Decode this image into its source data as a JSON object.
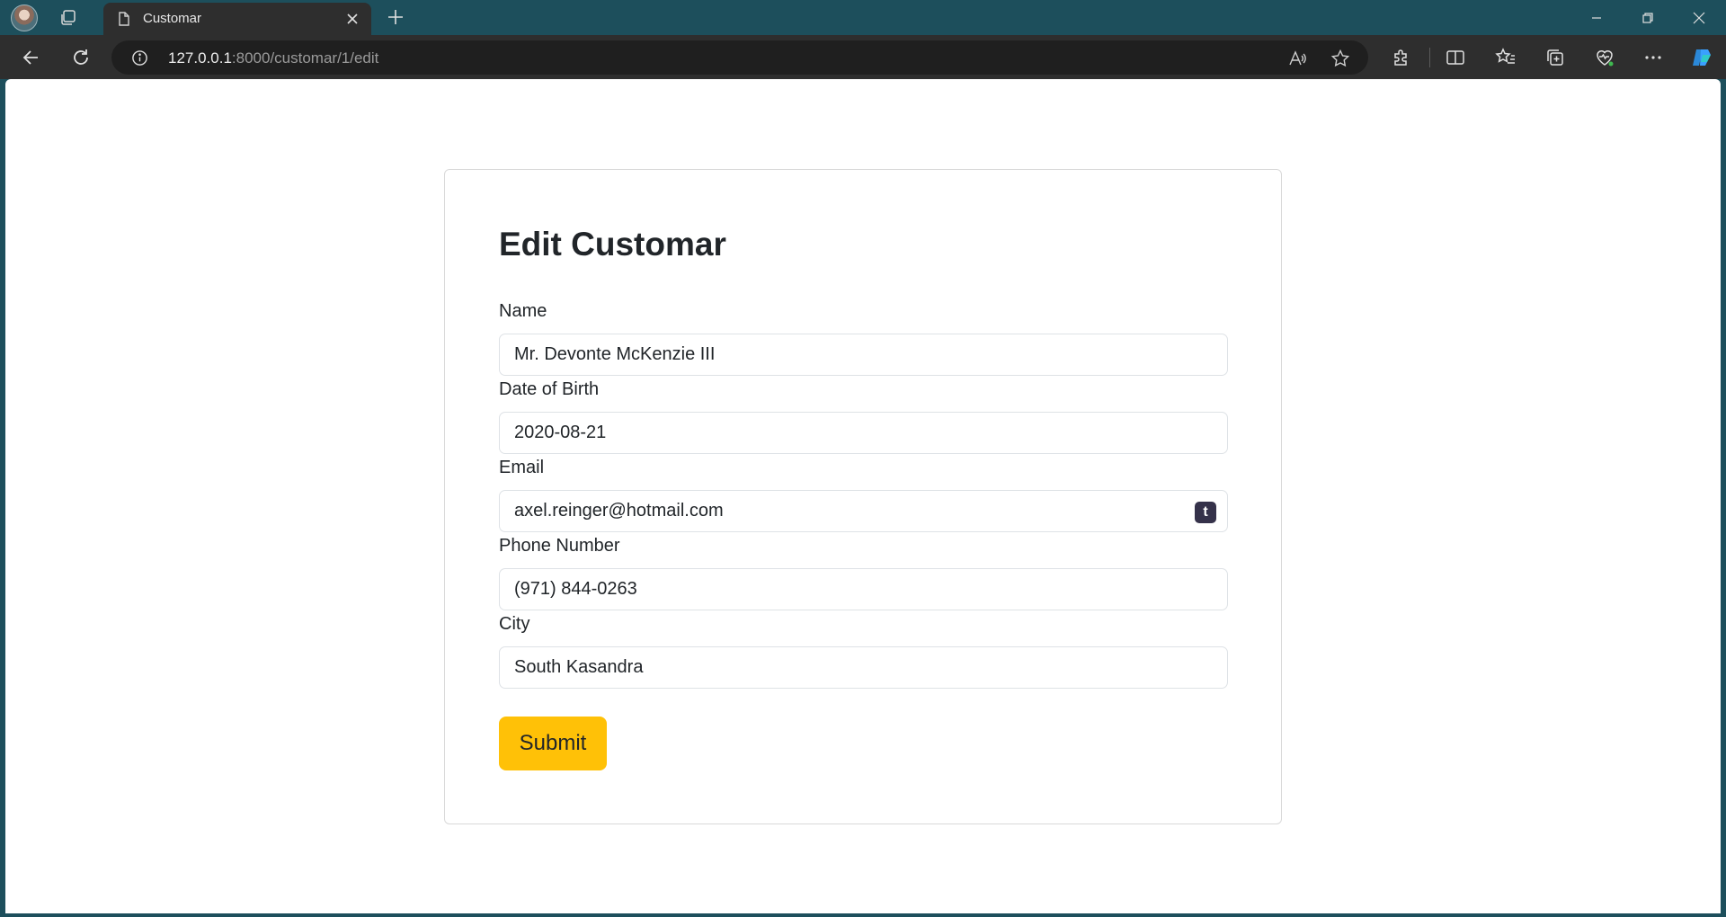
{
  "browser": {
    "tab_title": "Customar",
    "url_host": "127.0.0.1",
    "url_rest": ":8000/customar/1/edit"
  },
  "form": {
    "heading": "Edit Customar",
    "fields": [
      {
        "label": "Name",
        "value": "Mr. Devonte McKenzie III"
      },
      {
        "label": "Date of Birth",
        "value": "2020-08-21"
      },
      {
        "label": "Email",
        "value": "axel.reinger@hotmail.com"
      },
      {
        "label": "Phone Number",
        "value": "(971) 844-0263"
      },
      {
        "label": "City",
        "value": "South Kasandra"
      }
    ],
    "email_badge": "t",
    "submit_label": "Submit"
  },
  "colors": {
    "frame": "#1d4f5c",
    "toolbar": "#2e2e2e",
    "submit_bg": "#ffc107"
  }
}
